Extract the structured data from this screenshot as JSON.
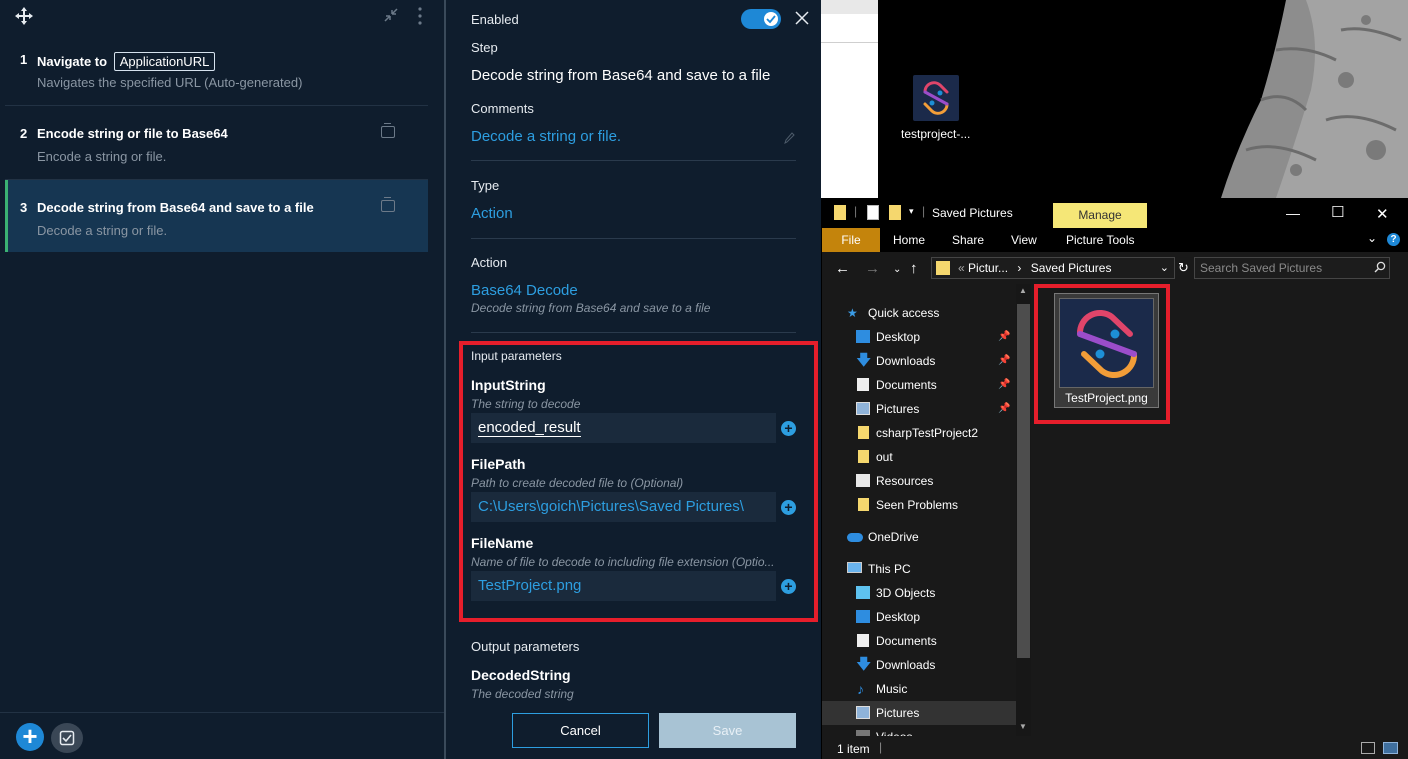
{
  "steps": {
    "items": [
      {
        "num": "1",
        "title_prefix": "Navigate to",
        "chip": "ApplicationURL",
        "desc": "Navigates the specified URL (Auto-generated)"
      },
      {
        "num": "2",
        "title": "Encode string or file to Base64",
        "desc": "Encode a string or file."
      },
      {
        "num": "3",
        "title": "Decode string from Base64 and save to a file",
        "desc": "Decode a string or file."
      }
    ],
    "add_label": "+"
  },
  "detail": {
    "enabled_label": "Enabled",
    "step_label": "Step",
    "step_value": "Decode string from Base64 and save to a file",
    "comments_label": "Comments",
    "comments_value": "Decode a string or file.",
    "type_label": "Type",
    "type_value": "Action",
    "action_label": "Action",
    "action_value": "Base64 Decode",
    "action_desc": "Decode string from Base64 and save to a file",
    "input_params_label": "Input parameters",
    "params": [
      {
        "name": "InputString",
        "desc": "The string to decode",
        "value": "encoded_result"
      },
      {
        "name": "FilePath",
        "desc": "Path to create decoded file to (Optional)",
        "value": "C:\\Users\\goich\\Pictures\\Saved Pictures\\"
      },
      {
        "name": "FileName",
        "desc": "Name of file to decode to including file extension (Optio...",
        "value": "TestProject.png"
      }
    ],
    "output_params_label": "Output parameters",
    "output": {
      "name": "DecodedString",
      "desc": "The decoded string"
    },
    "cancel_label": "Cancel",
    "save_label": "Save",
    "plus": "+"
  },
  "desktop": {
    "icon_label": "testproject-..."
  },
  "explorer": {
    "title": "Saved Pictures",
    "manage_tab": "Manage",
    "tabs": {
      "file": "File",
      "home": "Home",
      "share": "Share",
      "view": "View",
      "picture_tools": "Picture Tools"
    },
    "address": {
      "part1": "Pictur...",
      "sep": "›",
      "part2": "Saved Pictures",
      "prefix": "«"
    },
    "search_placeholder": "Search Saved Pictures",
    "nav": [
      {
        "label": "Quick access",
        "icon": "star-icon"
      },
      {
        "label": "Desktop",
        "icon": "desktop-icon",
        "pinned": true
      },
      {
        "label": "Downloads",
        "icon": "download-icon",
        "pinned": true
      },
      {
        "label": "Documents",
        "icon": "document-icon",
        "pinned": true
      },
      {
        "label": "Pictures",
        "icon": "pictures-icon",
        "pinned": true
      },
      {
        "label": "csharpTestProject2",
        "icon": "folder-icon"
      },
      {
        "label": "out",
        "icon": "folder-icon"
      },
      {
        "label": "Resources",
        "icon": "folder-icon"
      },
      {
        "label": "Seen Problems",
        "icon": "folder-icon"
      },
      {
        "label": "OneDrive",
        "icon": "cloud-icon"
      },
      {
        "label": "This PC",
        "icon": "pc-icon"
      },
      {
        "label": "3D Objects",
        "icon": "cube-icon"
      },
      {
        "label": "Desktop",
        "icon": "desktop-icon"
      },
      {
        "label": "Documents",
        "icon": "document-icon"
      },
      {
        "label": "Downloads",
        "icon": "download-icon"
      },
      {
        "label": "Music",
        "icon": "music-icon"
      },
      {
        "label": "Pictures",
        "icon": "pictures-icon"
      },
      {
        "label": "Videos",
        "icon": "video-icon"
      }
    ],
    "file": {
      "name": "TestProject.png"
    },
    "status": "1 item"
  }
}
